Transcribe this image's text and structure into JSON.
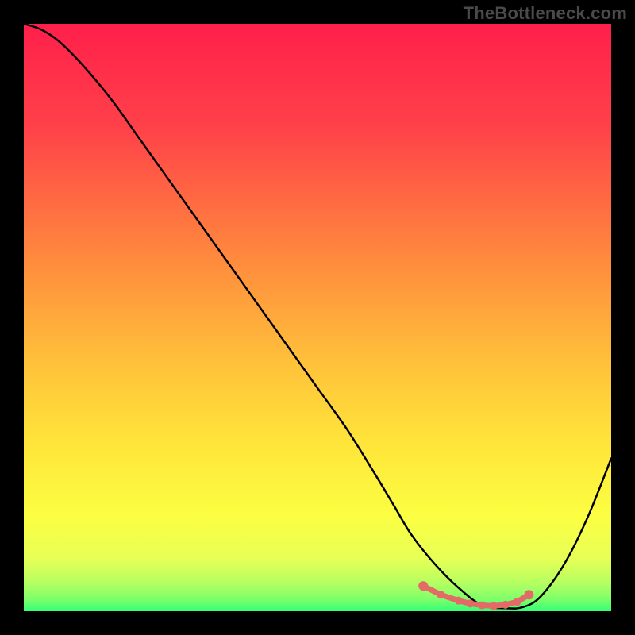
{
  "watermark": "TheBottleneck.com",
  "colors": {
    "curve": "#000000",
    "marker": "#e36a66",
    "frame": "#000000"
  },
  "chart_data": {
    "type": "line",
    "title": "",
    "xlabel": "",
    "ylabel": "",
    "xlim": [
      0,
      100
    ],
    "ylim": [
      0,
      100
    ],
    "x": [
      0,
      3,
      6,
      10,
      15,
      20,
      25,
      30,
      35,
      40,
      45,
      50,
      55,
      60,
      63,
      66,
      70,
      74,
      78,
      82,
      85,
      88,
      92,
      96,
      100
    ],
    "y": [
      100,
      99,
      97,
      93,
      87,
      80,
      73,
      66,
      59,
      52,
      45,
      38,
      31,
      23,
      18,
      13,
      8,
      4,
      1,
      0.5,
      0.7,
      2.5,
      8,
      16,
      26
    ],
    "optimal_range_x": [
      68,
      86
    ],
    "marker_x": [
      68,
      71,
      74,
      76,
      78,
      80,
      82,
      84,
      86
    ],
    "marker_y": [
      4.3,
      2.8,
      1.8,
      1.3,
      1.0,
      0.9,
      1.1,
      1.6,
      2.8
    ]
  }
}
